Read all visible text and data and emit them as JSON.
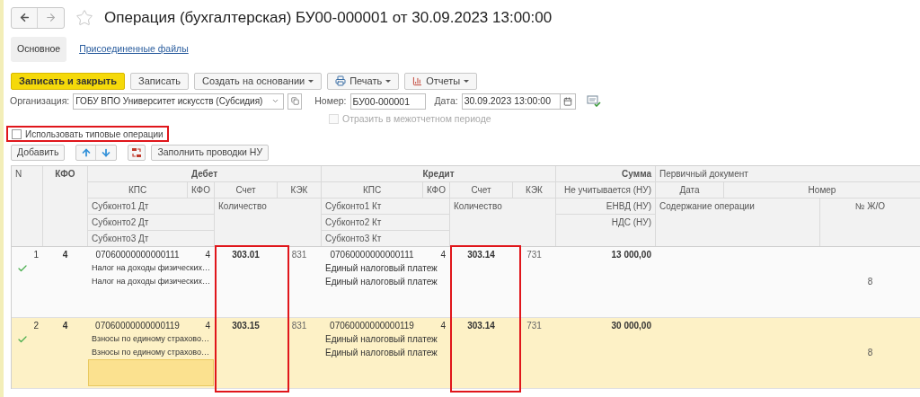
{
  "window": {
    "title": "Операция (бухгалтерская) БУ00-000001 от 30.09.2023 13:00:00"
  },
  "tabs": [
    {
      "label": "Основное",
      "selected": true
    },
    {
      "label": "Присоединенные файлы",
      "selected": false
    }
  ],
  "toolbar": [
    {
      "label": "Записать и закрыть",
      "kind": "primary"
    },
    {
      "label": "Записать",
      "kind": "plain"
    },
    {
      "label": "Создать на основании",
      "kind": "menu"
    },
    {
      "label": "Печать",
      "kind": "print"
    },
    {
      "label": "Отчеты",
      "kind": "report"
    }
  ],
  "form": {
    "organization": {
      "label": "Организация:",
      "value": "ГОБУ ВПО Университет искусств (Субсидия)"
    },
    "number": {
      "label": "Номер:",
      "value": "БУ00-000001"
    },
    "date": {
      "label": "Дата:",
      "value": "30.09.2023 13:00:00"
    },
    "interperiod": {
      "label": "Отразить в межотчетном периоде",
      "checked": false,
      "disabled": true
    }
  },
  "typical_operations": {
    "label": "Использовать типовые операции",
    "checked": false,
    "highlighted": true
  },
  "table_toolbar": {
    "add": "Добавить",
    "fill": "Заполнить проводки НУ"
  },
  "table": {
    "header": {
      "n": "N",
      "kfo": "КФО",
      "debit": "Дебет",
      "credit": "Кредит",
      "sum": "Сумма",
      "primary_doc": "Первичный документ",
      "debit_kps": "КПС",
      "debit_kfo": "КФО",
      "debit_account": "Счет",
      "debit_kek": "КЭК",
      "credit_kps": "КПС",
      "credit_kfo": "КФО",
      "credit_account": "Счет",
      "credit_kek": "КЭК",
      "not_counted": "Не учитывается (НУ)",
      "date": "Дата",
      "number": "Номер",
      "debit_sub1": "Субконто1 Дт",
      "debit_qty": "Количество",
      "credit_sub1": "Субконто1 Кт",
      "credit_qty": "Количество",
      "envd": "ЕНВД (НУ)",
      "content": "Содержание операции",
      "journal": "№ Ж/О",
      "debit_sub2": "Субконто2 Дт",
      "credit_sub2": "Субконто2 Кт",
      "nds": "НДС (НУ)",
      "debit_sub3": "Субконто3 Дт",
      "credit_sub3": "Субконто3 Кт"
    },
    "rows": [
      {
        "n": "1",
        "kfo": "4",
        "debit_kps": "07060000000000111",
        "debit_kfo": "4",
        "debit_account": "303.01",
        "debit_kek": "831",
        "credit_kps": "07060000000000111",
        "credit_kfo": "4",
        "credit_account": "303.14",
        "credit_kek": "731",
        "sum": "13 000,00",
        "checked": true,
        "debit_sub1": "Налог на доходы физических…",
        "debit_sub2": "Налог на доходы физических…",
        "credit_sub1": "Единый налоговый платеж",
        "credit_sub2": "Единый налоговый платеж",
        "journal": "8",
        "selected": false,
        "debit_sub3_selected": false
      },
      {
        "n": "2",
        "kfo": "4",
        "debit_kps": "07060000000000119",
        "debit_kfo": "4",
        "debit_account": "303.15",
        "debit_kek": "831",
        "credit_kps": "07060000000000119",
        "credit_kfo": "4",
        "credit_account": "303.14",
        "credit_kek": "731",
        "sum": "30 000,00",
        "checked": true,
        "debit_sub1": "Взносы по единому страхово…",
        "debit_sub2": "Взносы по единому страхово…",
        "credit_sub1": "Единый налоговый платеж",
        "credit_sub2": "Единый налоговый платеж",
        "journal": "8",
        "selected": true,
        "debit_sub3_selected": true
      }
    ],
    "debit_account_highlighted": true,
    "credit_account_highlighted": true
  }
}
